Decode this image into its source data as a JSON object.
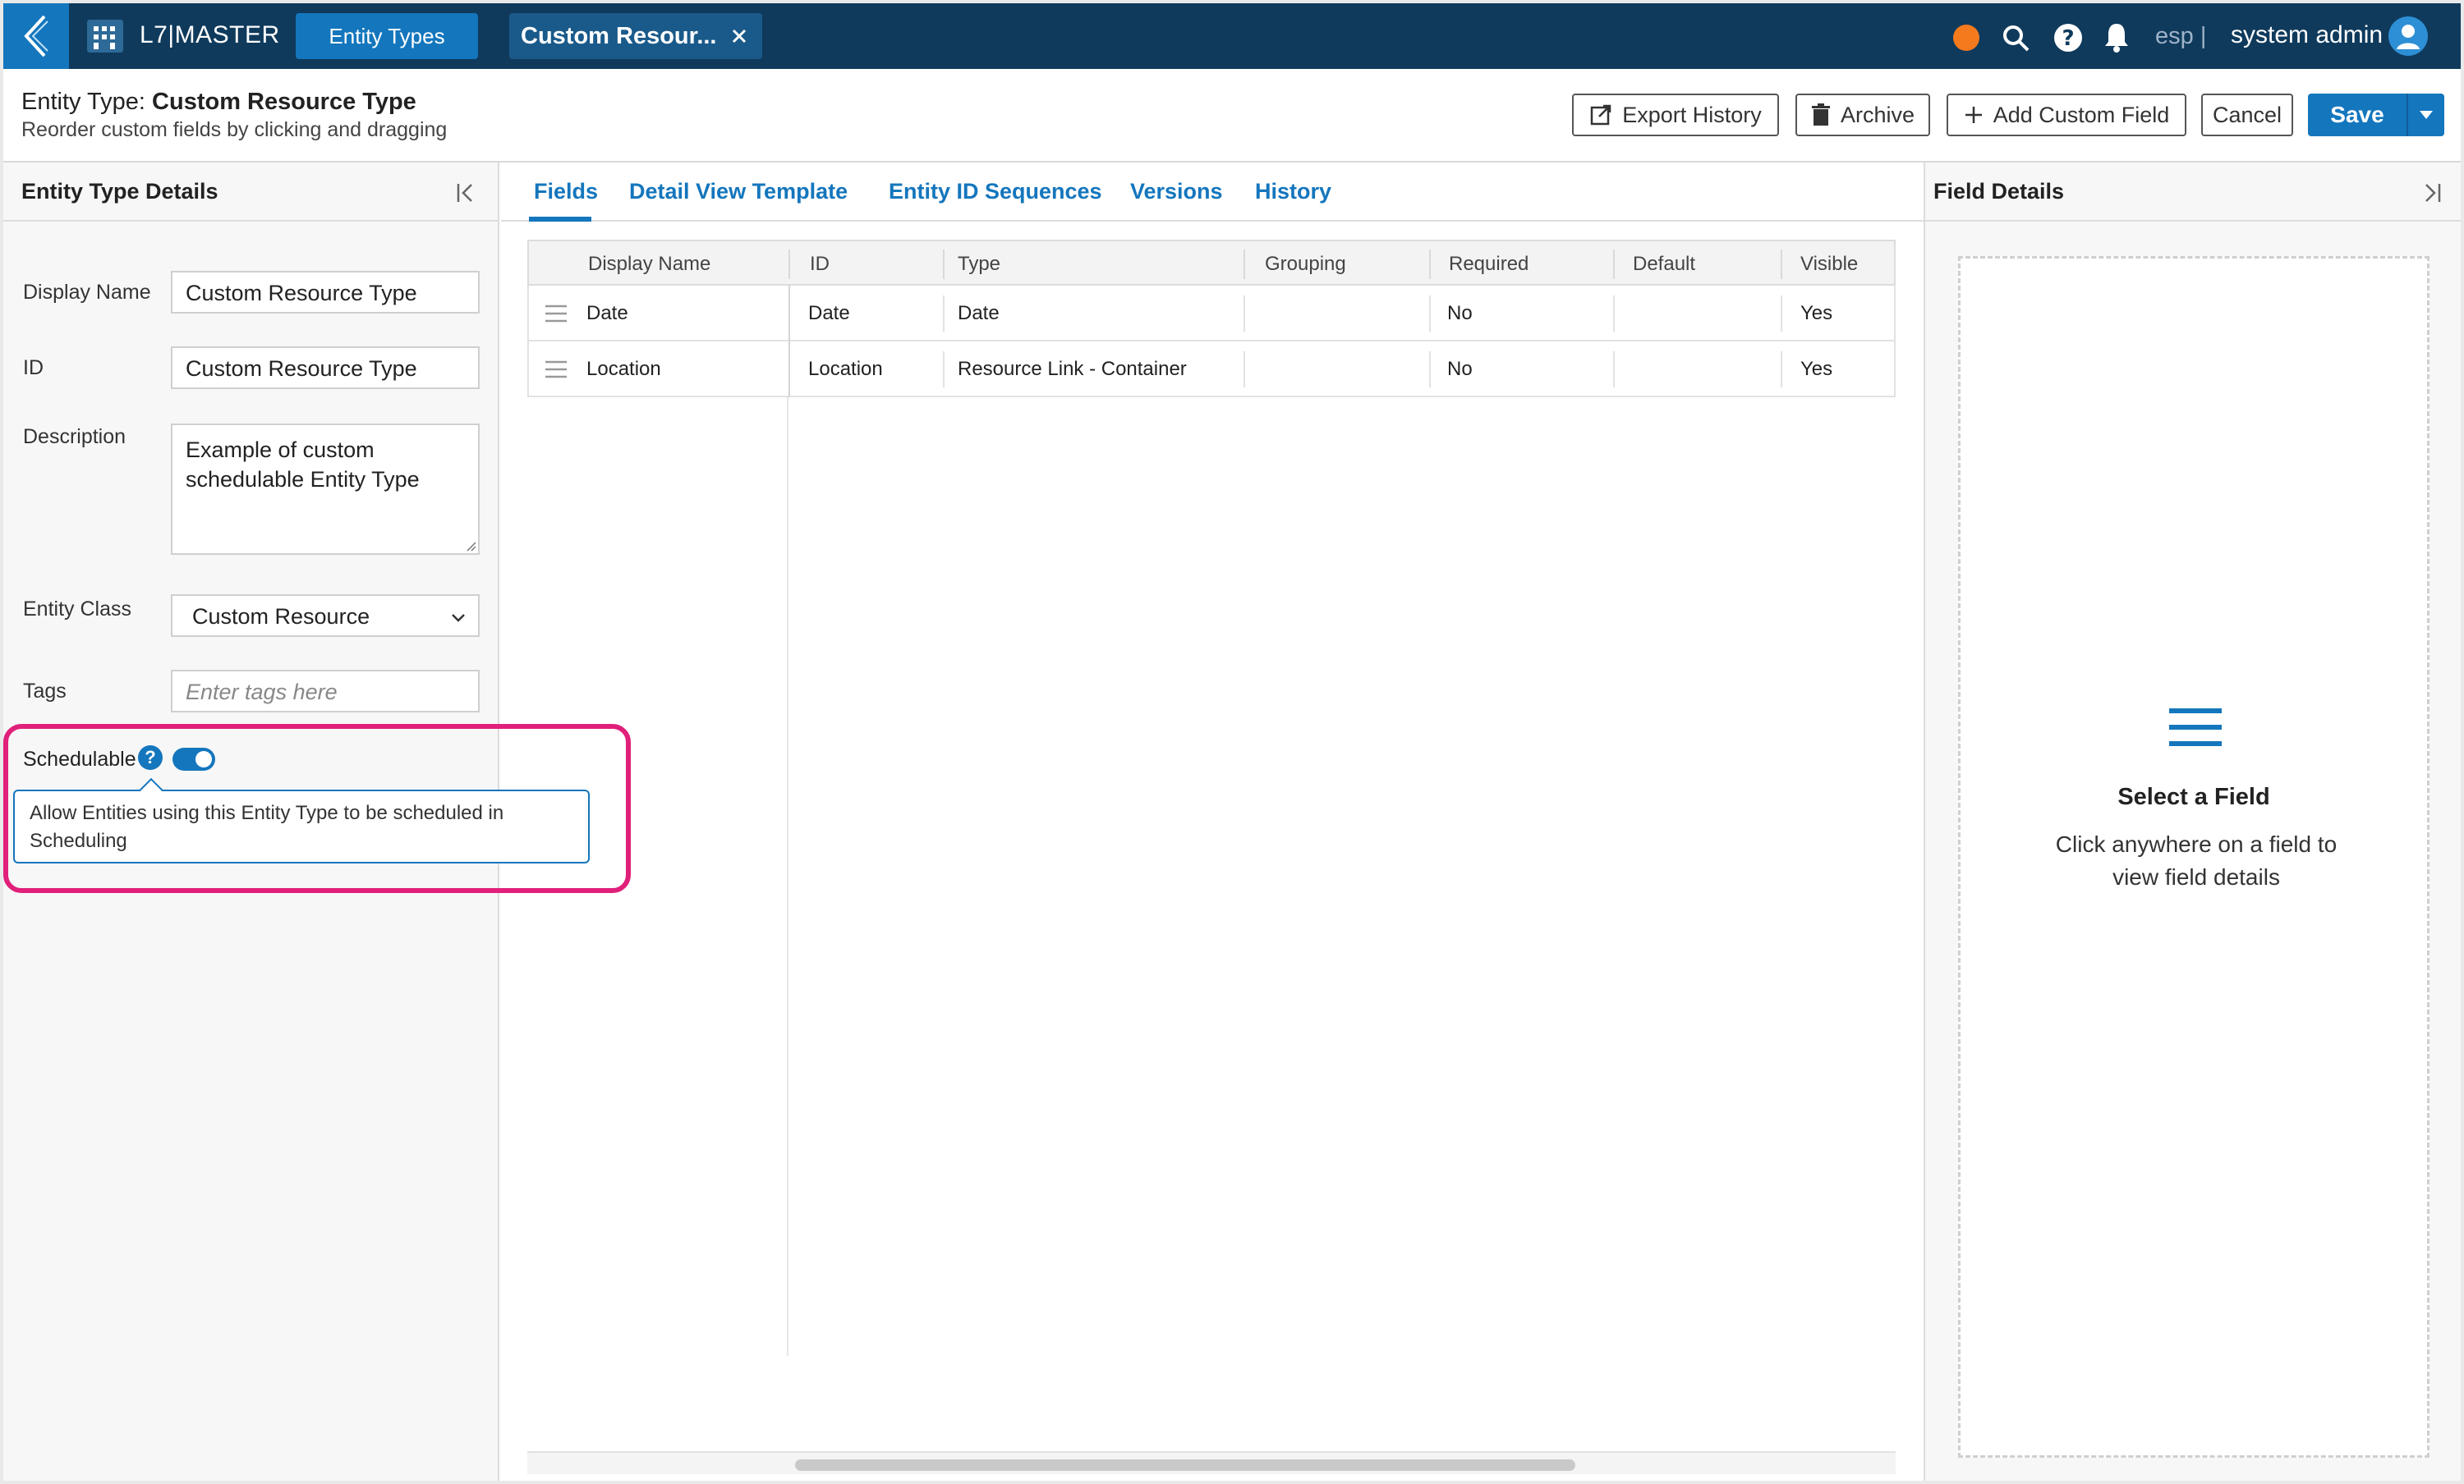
{
  "topbar": {
    "app_name": "L7|MASTER",
    "tab_entity_types": "Entity Types",
    "tab_current": "Custom Resour...",
    "lang": "esp |",
    "user": "system admin",
    "accent": "#1476bd",
    "bar_color": "#0f3a5c",
    "status_color": "#f57a1d"
  },
  "header": {
    "title_prefix": "Entity Type: ",
    "title_name": "Custom Resource Type",
    "subtitle": "Reorder custom fields by clicking and dragging",
    "export_history": "Export History",
    "archive": "Archive",
    "add_custom_field": "Add Custom Field",
    "cancel": "Cancel",
    "save": "Save"
  },
  "left_panel": {
    "title": "Entity Type Details",
    "display_name_label": "Display Name",
    "display_name_value": "Custom Resource Type",
    "id_label": "ID",
    "id_value": "Custom Resource Type",
    "description_label": "Description",
    "description_value": "Example of custom schedulable Entity Type",
    "entity_class_label": "Entity Class",
    "entity_class_value": "Custom Resource",
    "tags_label": "Tags",
    "tags_placeholder": "Enter tags here",
    "schedulable_label": "Schedulable",
    "schedulable_on": true,
    "tooltip": "Allow Entities using this Entity Type to be scheduled in Scheduling",
    "highlight_color": "#e0207a"
  },
  "tabs": [
    "Fields",
    "Detail View Template",
    "Entity ID Sequences",
    "Versions",
    "History"
  ],
  "grid": {
    "columns": [
      "Display Name",
      "ID",
      "Type",
      "Grouping",
      "Required",
      "Default",
      "Visible"
    ],
    "rows": [
      [
        "Date",
        "Date",
        "Date",
        "",
        "No",
        "",
        "Yes"
      ],
      [
        "Location",
        "Location",
        "Resource Link - Container",
        "",
        "No",
        "",
        "Yes"
      ]
    ]
  },
  "right_panel": {
    "title": "Field Details",
    "empty_title": "Select a Field",
    "empty_desc": "Click anywhere on a field to view field details"
  }
}
